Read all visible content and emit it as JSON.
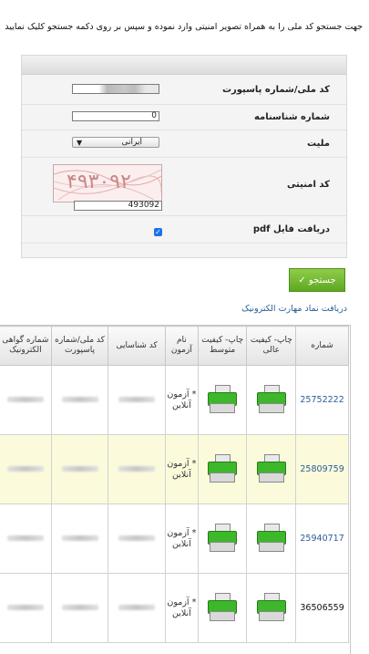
{
  "intro": "جهت جستجو کد ملی را به همراه تصویر امنیتی وارد نموده و سپس بر روی دکمه جستجو کلیک نمایید",
  "form": {
    "national_code_label": "کد ملی/شماره پاسپورت",
    "birth_cert_label": "شماره شناسنامه",
    "birth_cert_value": "0",
    "nationality_label": "ملیت",
    "nationality_value": "ایرانی",
    "captcha_label": "کد امنیتی",
    "captcha_image_text": "۴۹۳۰۹۲",
    "captcha_value": "493092",
    "pdf_label": "دریافت فایل pdf"
  },
  "search_button": "جستجو ✓",
  "link_text": "دریافت نماد مهارت الکترونیک",
  "table": {
    "headers": [
      "شماره",
      "چاپ- کیفیت عالی",
      "چاپ- کیفیت متوسط",
      "نام آزمون",
      "کد شناسایی",
      "کد ملی/شماره پاسپورت",
      "شماره گواهی الکترونیک"
    ],
    "rows": [
      {
        "number": "25752222",
        "exam": "* آزمون آنلاین"
      },
      {
        "number": "25809759",
        "exam": "* آزمون آنلاین"
      },
      {
        "number": "25940717",
        "exam": "* آزمون آنلاین"
      },
      {
        "number": "36506559",
        "exam": "* آزمون آنلاین"
      }
    ]
  },
  "colors": {
    "accent_green": "#5ea821",
    "link_blue": "#2a5d95",
    "highlight_row": "#fbfbdc"
  }
}
